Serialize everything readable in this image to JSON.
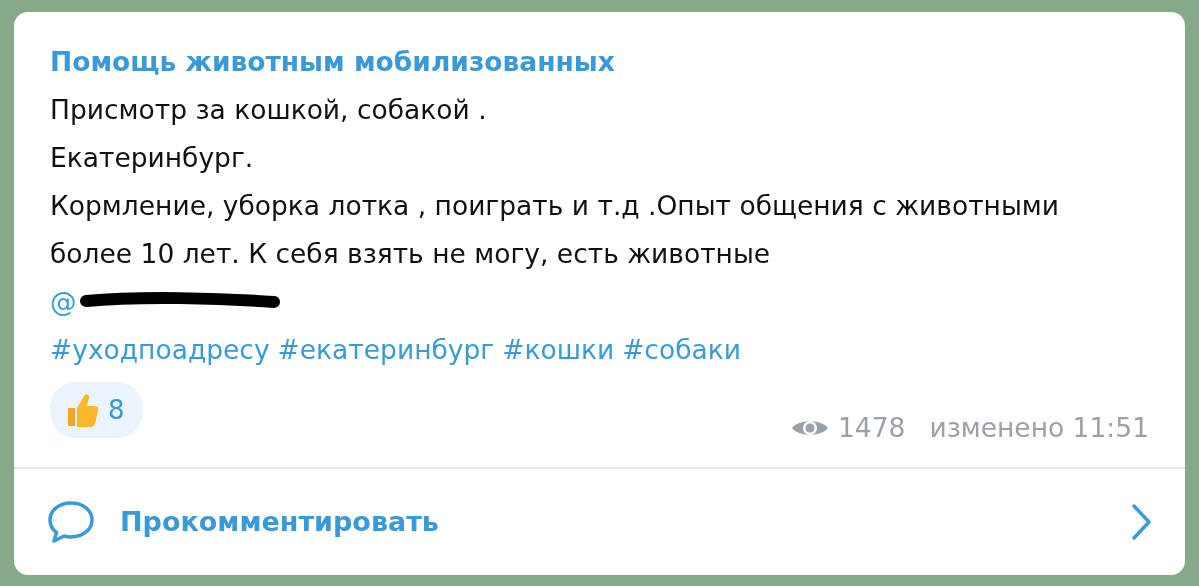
{
  "channel_name": "Помощь животным мобилизованных",
  "message_lines": [
    "Присмотр за кошкой, собакой .",
    "Екатеринбург.",
    "Кормление, уборка лотка , поиграть и т.д .Опыт общения с животными более 10 лет. К себя взять не могу, есть животные"
  ],
  "mention": "@",
  "hashtags": [
    "#уходпоадресу",
    "#екатеринбург",
    "#кошки",
    "#собаки"
  ],
  "reaction": {
    "count": "8",
    "selected": false
  },
  "views": "1478",
  "edited_time": "изменено 11:51",
  "comment_button": "Прокомментировать"
}
